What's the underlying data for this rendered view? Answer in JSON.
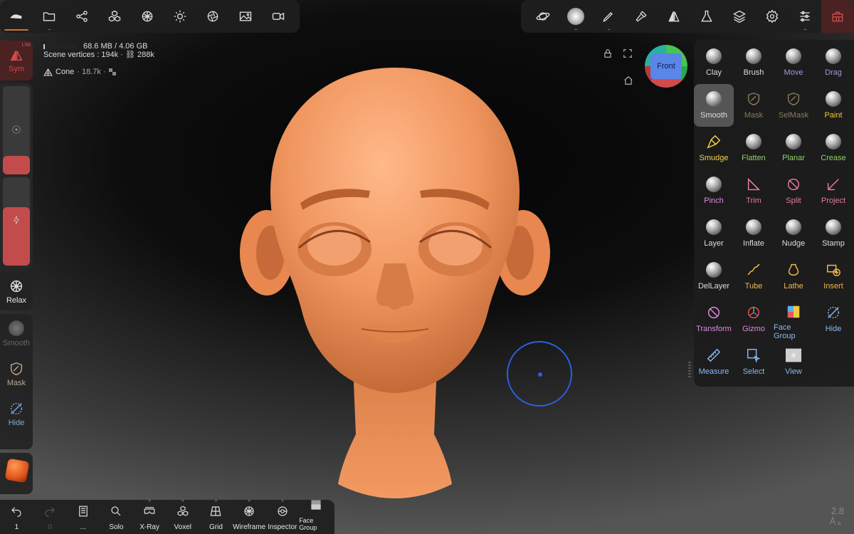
{
  "stats": {
    "memory": "68.6 MB / 4.06 GB",
    "vertices": "Scene vertices : 194k · ⛓ 288k"
  },
  "mesh": {
    "name": "Cone",
    "detail": "· 18.7k ·"
  },
  "sym": {
    "label": "Sym",
    "corner": "L/W"
  },
  "relax": {
    "label": "Relax"
  },
  "left_tools": [
    {
      "label": "Smooth",
      "color": "#666666"
    },
    {
      "label": "Mask",
      "color": "#b8a98a"
    },
    {
      "label": "Hide",
      "color": "#7faadf"
    }
  ],
  "cube": {
    "label": "Front"
  },
  "tools": [
    {
      "label": "Clay",
      "color": "#dddddd",
      "icon": "ball"
    },
    {
      "label": "Brush",
      "color": "#dddddd",
      "icon": "ball"
    },
    {
      "label": "Move",
      "color": "#9b9bdd",
      "icon": "ball"
    },
    {
      "label": "Drag",
      "color": "#9b9bdd",
      "icon": "ball"
    },
    {
      "label": "Smooth",
      "color": "#dddddd",
      "icon": "ball"
    },
    {
      "label": "Mask",
      "color": "#8a7a5a",
      "icon": "shield"
    },
    {
      "label": "SelMask",
      "color": "#8a7a5a",
      "icon": "shield"
    },
    {
      "label": "Paint",
      "color": "#f2c83c",
      "icon": "ball"
    },
    {
      "label": "Smudge",
      "color": "#f2d34a",
      "icon": "brush"
    },
    {
      "label": "Flatten",
      "color": "#8ed36a",
      "icon": "ball"
    },
    {
      "label": "Planar",
      "color": "#8ed36a",
      "icon": "ball"
    },
    {
      "label": "Crease",
      "color": "#8ed36a",
      "icon": "ball"
    },
    {
      "label": "Pinch",
      "color": "#dd8ae0",
      "icon": "ball"
    },
    {
      "label": "Trim",
      "color": "#e67a9c",
      "icon": "trim"
    },
    {
      "label": "Split",
      "color": "#e67a9c",
      "icon": "split"
    },
    {
      "label": "Project",
      "color": "#e67a9c",
      "icon": "project"
    },
    {
      "label": "Layer",
      "color": "#dddddd",
      "icon": "ball"
    },
    {
      "label": "Inflate",
      "color": "#dddddd",
      "icon": "ball"
    },
    {
      "label": "Nudge",
      "color": "#dddddd",
      "icon": "ball"
    },
    {
      "label": "Stamp",
      "color": "#dddddd",
      "icon": "ball"
    },
    {
      "label": "DelLayer",
      "color": "#dddddd",
      "icon": "ball"
    },
    {
      "label": "Tube",
      "color": "#f2b84a",
      "icon": "tube"
    },
    {
      "label": "Lathe",
      "color": "#f2b84a",
      "icon": "lathe"
    },
    {
      "label": "Insert",
      "color": "#f2b84a",
      "icon": "insert"
    },
    {
      "label": "Transform",
      "color": "#dd8ae0",
      "icon": "transform"
    },
    {
      "label": "Gizmo",
      "color": "#dd8ae0",
      "icon": "gizmo"
    },
    {
      "label": "Face Group",
      "color": "#8ab8f0",
      "icon": "facegroup"
    },
    {
      "label": "Hide",
      "color": "#8ab8f0",
      "icon": "hide"
    },
    {
      "label": "Measure",
      "color": "#8ab8f0",
      "icon": "measure"
    },
    {
      "label": "Select",
      "color": "#8ab8f0",
      "icon": "select"
    },
    {
      "label": "View",
      "color": "#8ab8f0",
      "icon": "view"
    }
  ],
  "bottom": [
    {
      "label": "1",
      "icon": "undo"
    },
    {
      "label": "0",
      "icon": "redo"
    },
    {
      "label": "...",
      "icon": "book"
    },
    {
      "label": "Solo",
      "icon": "search"
    },
    {
      "label": "X-Ray",
      "icon": "xray"
    },
    {
      "label": "Voxel",
      "icon": "voxel"
    },
    {
      "label": "Grid",
      "icon": "grid"
    },
    {
      "label": "Wireframe",
      "icon": "wire"
    },
    {
      "label": "Inspector",
      "icon": "inspector"
    },
    {
      "label": "Face Group",
      "icon": "face"
    }
  ],
  "version": {
    "number": "2.8"
  }
}
